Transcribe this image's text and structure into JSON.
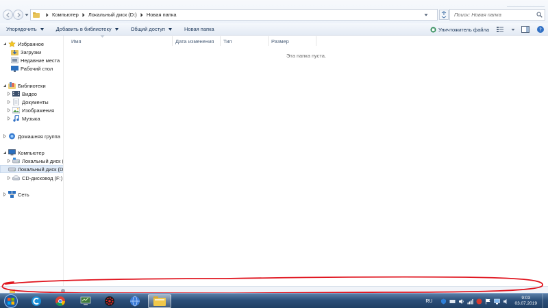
{
  "addressbar": {
    "crumbs": [
      "Компьютер",
      "Локальный диск (D:)",
      "Новая папка"
    ],
    "search_placeholder": "Поиск: Новая папка"
  },
  "commandbar": {
    "items": [
      {
        "label": "Упорядочить",
        "dropdown": true
      },
      {
        "label": "Добавить в библиотеку",
        "dropdown": true
      },
      {
        "label": "Общий доступ",
        "dropdown": true
      },
      {
        "label": "Новая папка",
        "dropdown": false
      }
    ],
    "extension_label": "Уничтожитель файла"
  },
  "navpane": {
    "favorites": {
      "label": "Избранное",
      "items": [
        "Загрузки",
        "Недавние места",
        "Рабочий стол"
      ]
    },
    "libraries": {
      "label": "Библиотеки",
      "items": [
        "Видео",
        "Документы",
        "Изображения",
        "Музыка"
      ]
    },
    "homegroup": {
      "label": "Домашняя группа"
    },
    "computer": {
      "label": "Компьютер",
      "items": [
        "Локальный диск (C",
        "Локальный диск (D",
        "CD-дисковод (F:)"
      ]
    },
    "network": {
      "label": "Сеть"
    }
  },
  "content": {
    "columns": [
      "Имя",
      "Дата изменения",
      "Тип",
      "Размер"
    ],
    "empty_message": "Эта папка пуста."
  },
  "taskbar": {
    "language": "RU",
    "time": "9:03",
    "date": "03.07.2019"
  },
  "colors": {
    "annotation": "#e0141e",
    "selection": "#dfeaf7",
    "taskbar": "#2c4f79"
  }
}
